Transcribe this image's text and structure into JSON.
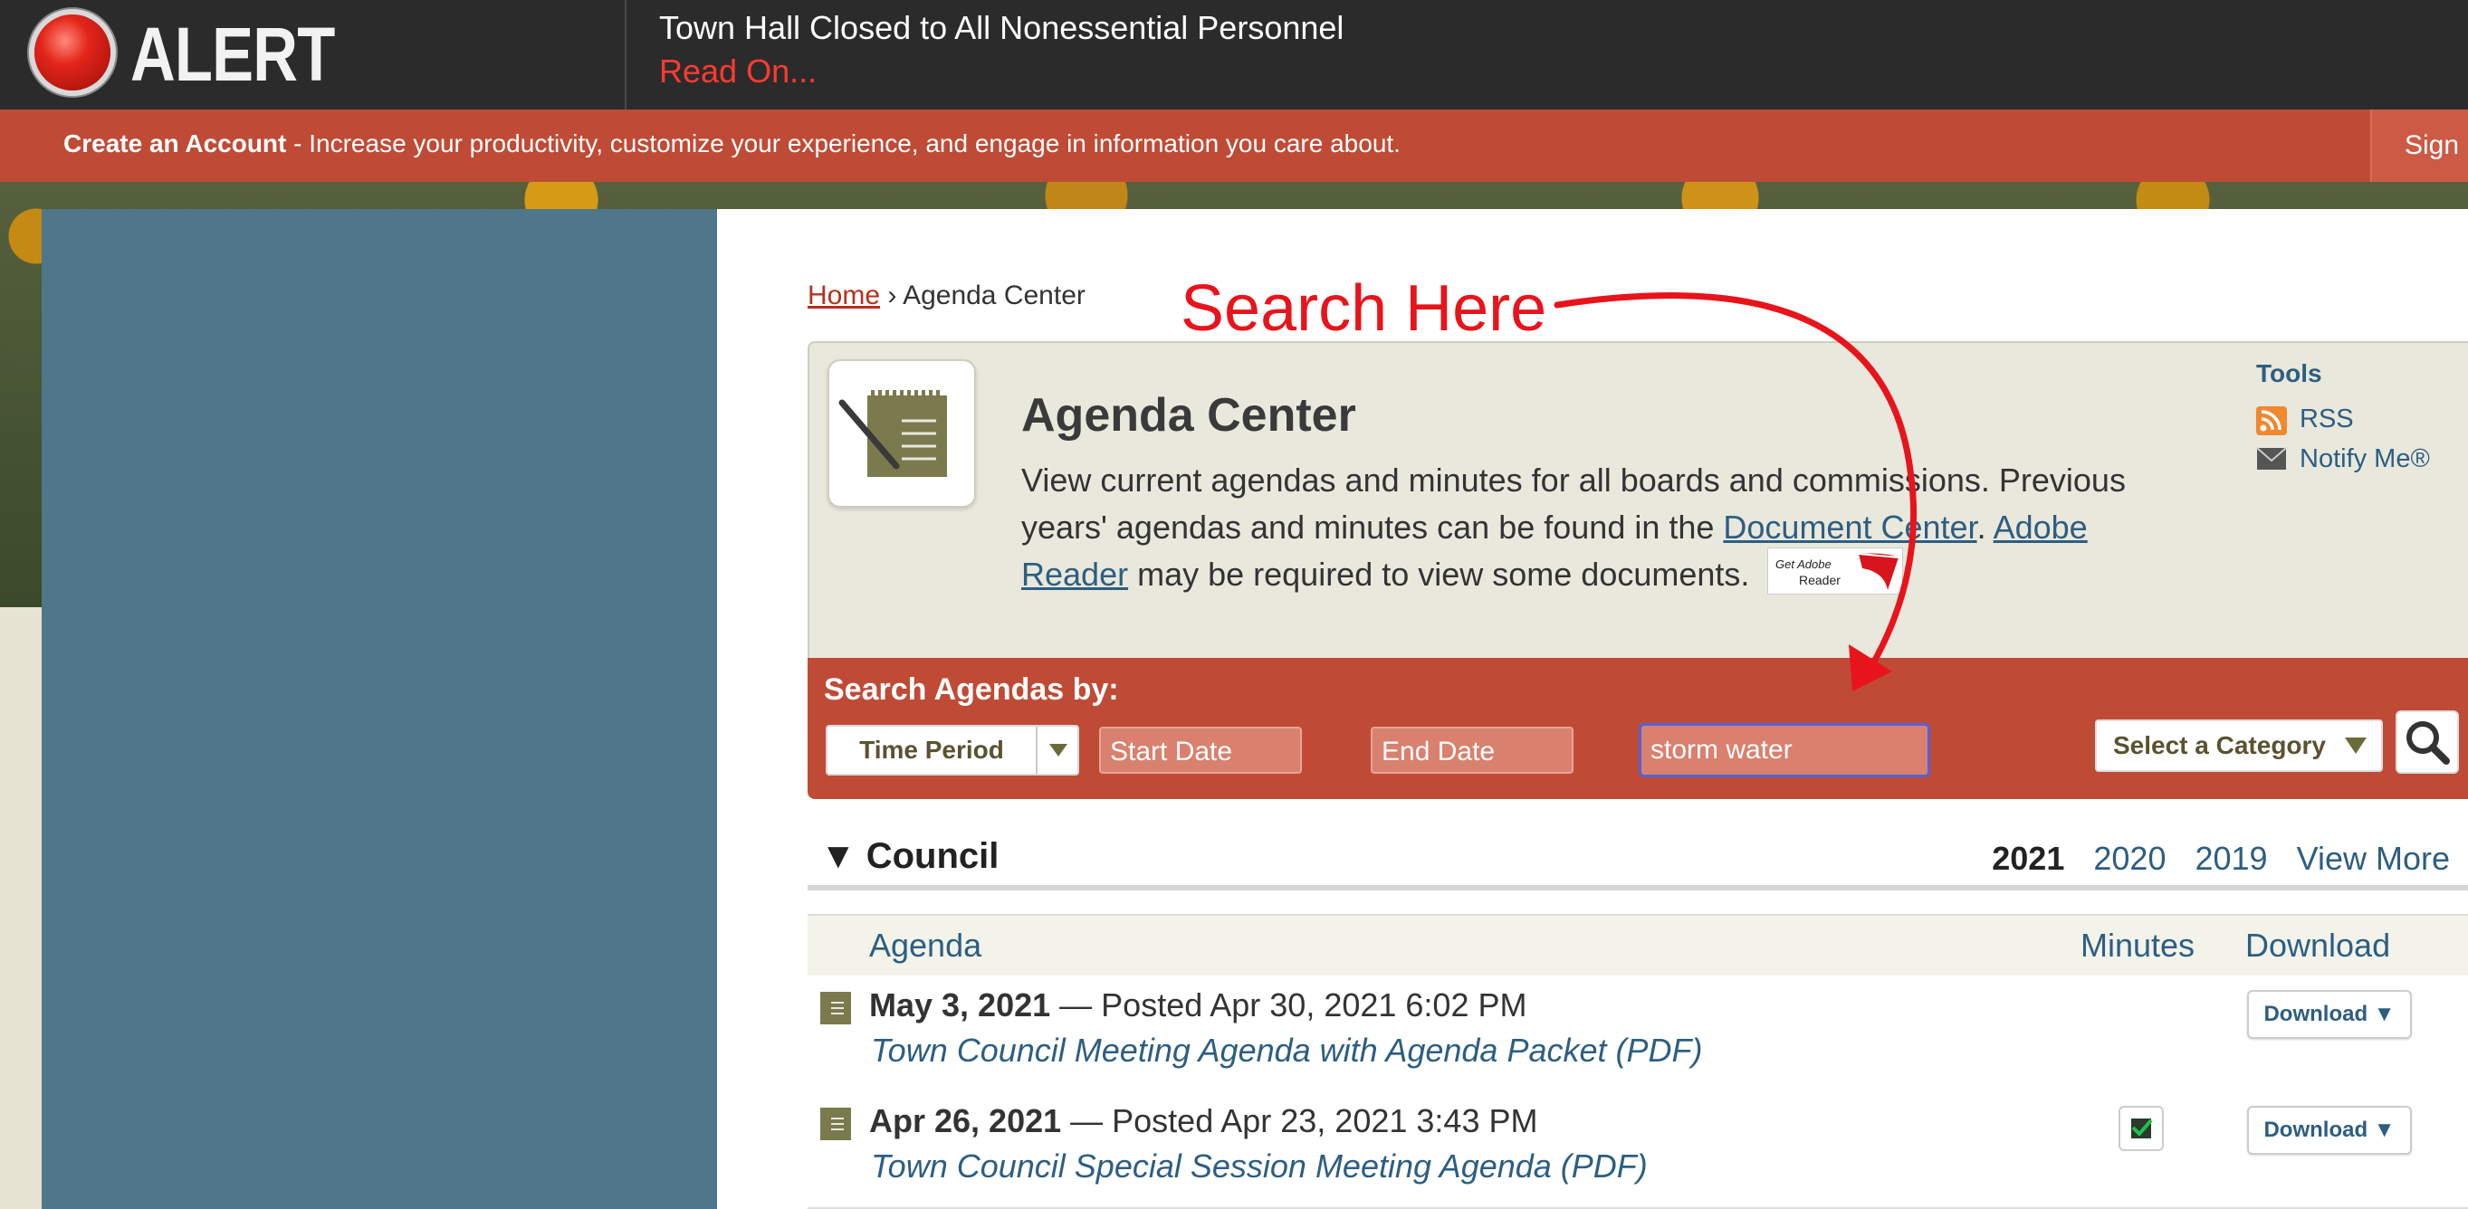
{
  "alert": {
    "badge": "ALERT",
    "message": "Town Hall Closed to All Nonessential Personnel",
    "link": "Read On..."
  },
  "account_bar": {
    "create_label": "Create an Account",
    "create_text": " - Increase your productivity, customize your experience, and engage in information you care about.",
    "sign_in": "Sign In"
  },
  "breadcrumb": {
    "home": "Home",
    "separator": "›",
    "current": "Agenda Center"
  },
  "annotation": {
    "text": "Search Here",
    "color": "#e8141c"
  },
  "agenda": {
    "title": "Agenda Center",
    "desc_part1": "View current agendas and minutes for all boards and commissions. Previous years' agendas and minutes can be found in the ",
    "document_center_link": "Document Center",
    "desc_sep": ". ",
    "adobe_link": "Adobe Reader",
    "desc_part2": " may be required to view some documents.",
    "adobe_badge_line1": "Get Adobe",
    "adobe_badge_line2": "Reader"
  },
  "tools": {
    "title": "Tools",
    "rss": "RSS",
    "notify": "Notify Me®"
  },
  "search": {
    "label": "Search Agendas by:",
    "time_period": "Time Period",
    "start_date_placeholder": "Start Date",
    "end_date_placeholder": "End Date",
    "keyword_value": "storm water",
    "category": "Select a Category"
  },
  "council": {
    "title": "Council",
    "years": [
      "2021",
      "2020",
      "2019"
    ],
    "view_more": "View More"
  },
  "table": {
    "col_agenda": "Agenda",
    "col_minutes": "Minutes",
    "col_download": "Download",
    "rows": [
      {
        "date": "May 3, 2021",
        "posted": " — Posted Apr 30, 2021 6:02 PM",
        "title": "Town Council Meeting Agenda with Agenda Packet (PDF)",
        "download": "Download ▼"
      },
      {
        "date": "Apr 26, 2021",
        "posted": " — Posted Apr 23, 2021 3:43 PM",
        "title": "Town Council Special Session Meeting Agenda (PDF)",
        "download": "Download ▼"
      }
    ]
  },
  "colors": {
    "alert_bg": "#2b2b2b",
    "brand_red": "#bf4b36",
    "sidebar_blue": "#4f7689",
    "link_blue": "#2d5e82"
  }
}
